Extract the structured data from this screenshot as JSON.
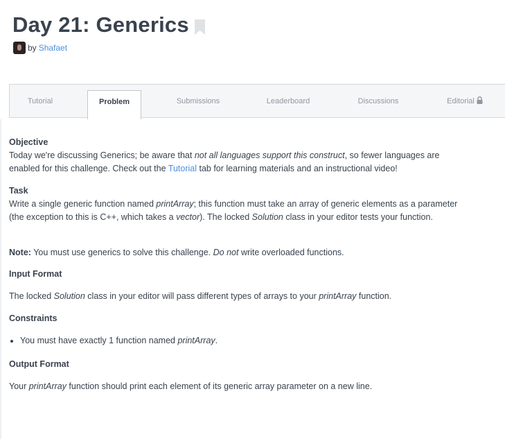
{
  "header": {
    "title": "Day 21: Generics",
    "by_label": "by",
    "author": "Shafaet"
  },
  "tabs": [
    {
      "label": "Tutorial",
      "active": false
    },
    {
      "label": "Problem",
      "active": true
    },
    {
      "label": "Submissions",
      "active": false
    },
    {
      "label": "Leaderboard",
      "active": false
    },
    {
      "label": "Discussions",
      "active": false
    },
    {
      "label": "Editorial",
      "active": false,
      "locked": true
    }
  ],
  "objective": {
    "heading": "Objective",
    "text_1": "Today we're discussing Generics; be aware that ",
    "text_em": "not all languages support this construct",
    "text_2": ", so fewer languages are enabled for this challenge. Check out the ",
    "link": "Tutorial",
    "text_3": " tab for learning materials and an instructional video!"
  },
  "task": {
    "heading": "Task",
    "t1": "Write a single generic function named ",
    "e1": "printArray",
    "t2": "; this function must take an array of generic elements as a parameter (the exception to this is C++, which takes a ",
    "e2": "vector",
    "t3": "). The locked ",
    "e3": "Solution",
    "t4": " class in your editor tests your function."
  },
  "note": {
    "label": "Note:",
    "t1": " You must use generics to solve this challenge. ",
    "e1": "Do not",
    "t2": " write overloaded functions."
  },
  "input_format": {
    "heading": "Input Format",
    "t1": "The locked ",
    "e1": "Solution",
    "t2": " class in your editor will pass different types of arrays to your ",
    "e2": "printArray",
    "t3": " function."
  },
  "constraints": {
    "heading": "Constraints",
    "t1": "You must have exactly 1 function named ",
    "e1": "printArray",
    "t2": "."
  },
  "output_format": {
    "heading": "Output Format",
    "t1": "Your ",
    "e1": "printArray",
    "t2": " function should print each element of its generic array parameter on a new line."
  },
  "colors": {
    "text": "#39424e",
    "link": "#4a90d9",
    "tab_inactive": "#8f98a3"
  }
}
